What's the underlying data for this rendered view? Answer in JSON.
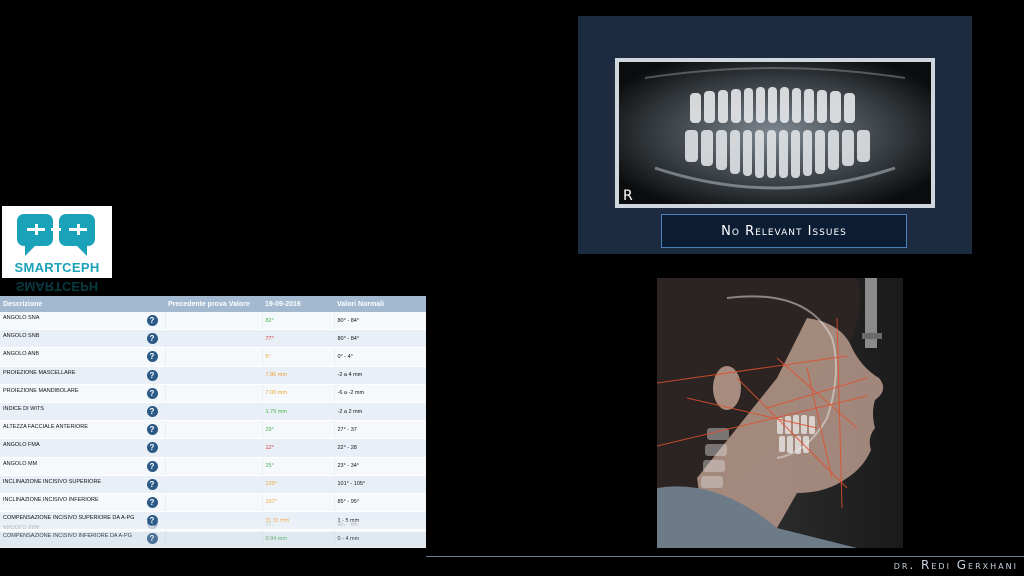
{
  "pano": {
    "side_marker": "R",
    "status": "No Relevant Issues"
  },
  "logo": {
    "text": "SMARTCEPH"
  },
  "table": {
    "headers": [
      "Descrizione",
      "Precedente prova Valore",
      "19-09-2016",
      "Valori Normali"
    ],
    "rows": [
      {
        "desc": "ANGOLO SNA",
        "prev": "",
        "value": "82°",
        "value_color": "#4caf50",
        "normal": "80° - 84°"
      },
      {
        "desc": "ANGOLO SNB",
        "prev": "",
        "value": "77°",
        "value_color": "#d23a3a",
        "normal": "80° - 84°"
      },
      {
        "desc": "ANGOLO ANB",
        "prev": "",
        "value": "5°",
        "value_color": "#f0a030",
        "normal": "0° - 4°"
      },
      {
        "desc": "PROIEZIONE MASCELLARE",
        "prev": "",
        "value": "7.86 mm",
        "value_color": "#f0a030",
        "normal": "-2 a 4 mm"
      },
      {
        "desc": "PROIEZIONE MANDIBOLARE",
        "prev": "",
        "value": "7.00 mm",
        "value_color": "#f0a030",
        "normal": "-6 a -2 mm"
      },
      {
        "desc": "INDICE DI WITS",
        "prev": "",
        "value": "1.79 mm",
        "value_color": "#4caf50",
        "normal": "-2 a 2 mm"
      },
      {
        "desc": "ALTEZZA FACCIALE ANTERIORE",
        "prev": "",
        "value": "29°",
        "value_color": "#4caf50",
        "normal": "27° - 37"
      },
      {
        "desc": "ANGOLO FMA",
        "prev": "",
        "value": "12°",
        "value_color": "#d23a3a",
        "normal": "22° - 28"
      },
      {
        "desc": "ANGOLO MM",
        "prev": "",
        "value": "25°",
        "value_color": "#4caf50",
        "normal": "23° - 34°"
      },
      {
        "desc": "INCLINAZIONE INCISIVO SUPERIORE",
        "prev": "",
        "value": "120°",
        "value_color": "#f0a030",
        "normal": "101° - 105°"
      },
      {
        "desc": "INCLINAZIONE INCISIVO INFERIORE",
        "prev": "",
        "value": "107°",
        "value_color": "#f0a030",
        "normal": "85° - 95°"
      },
      {
        "desc": "COMPENSAZIONE INCISIVO SUPERIORE DA A-PG",
        "prev": "",
        "value": "11.11 mm",
        "value_color": "#f0a030",
        "normal": "1 - 5 mm"
      },
      {
        "desc": "COMPENSAZIONE INCISIVO INFERIORE DA A-PG",
        "prev": "",
        "value": "0.94 mm",
        "value_color": "#4caf50",
        "normal": "0 - 4 mm"
      }
    ],
    "help_icon": "question-circle-icon"
  },
  "footer": {
    "signature": "dr. Redi Gerxhani"
  }
}
